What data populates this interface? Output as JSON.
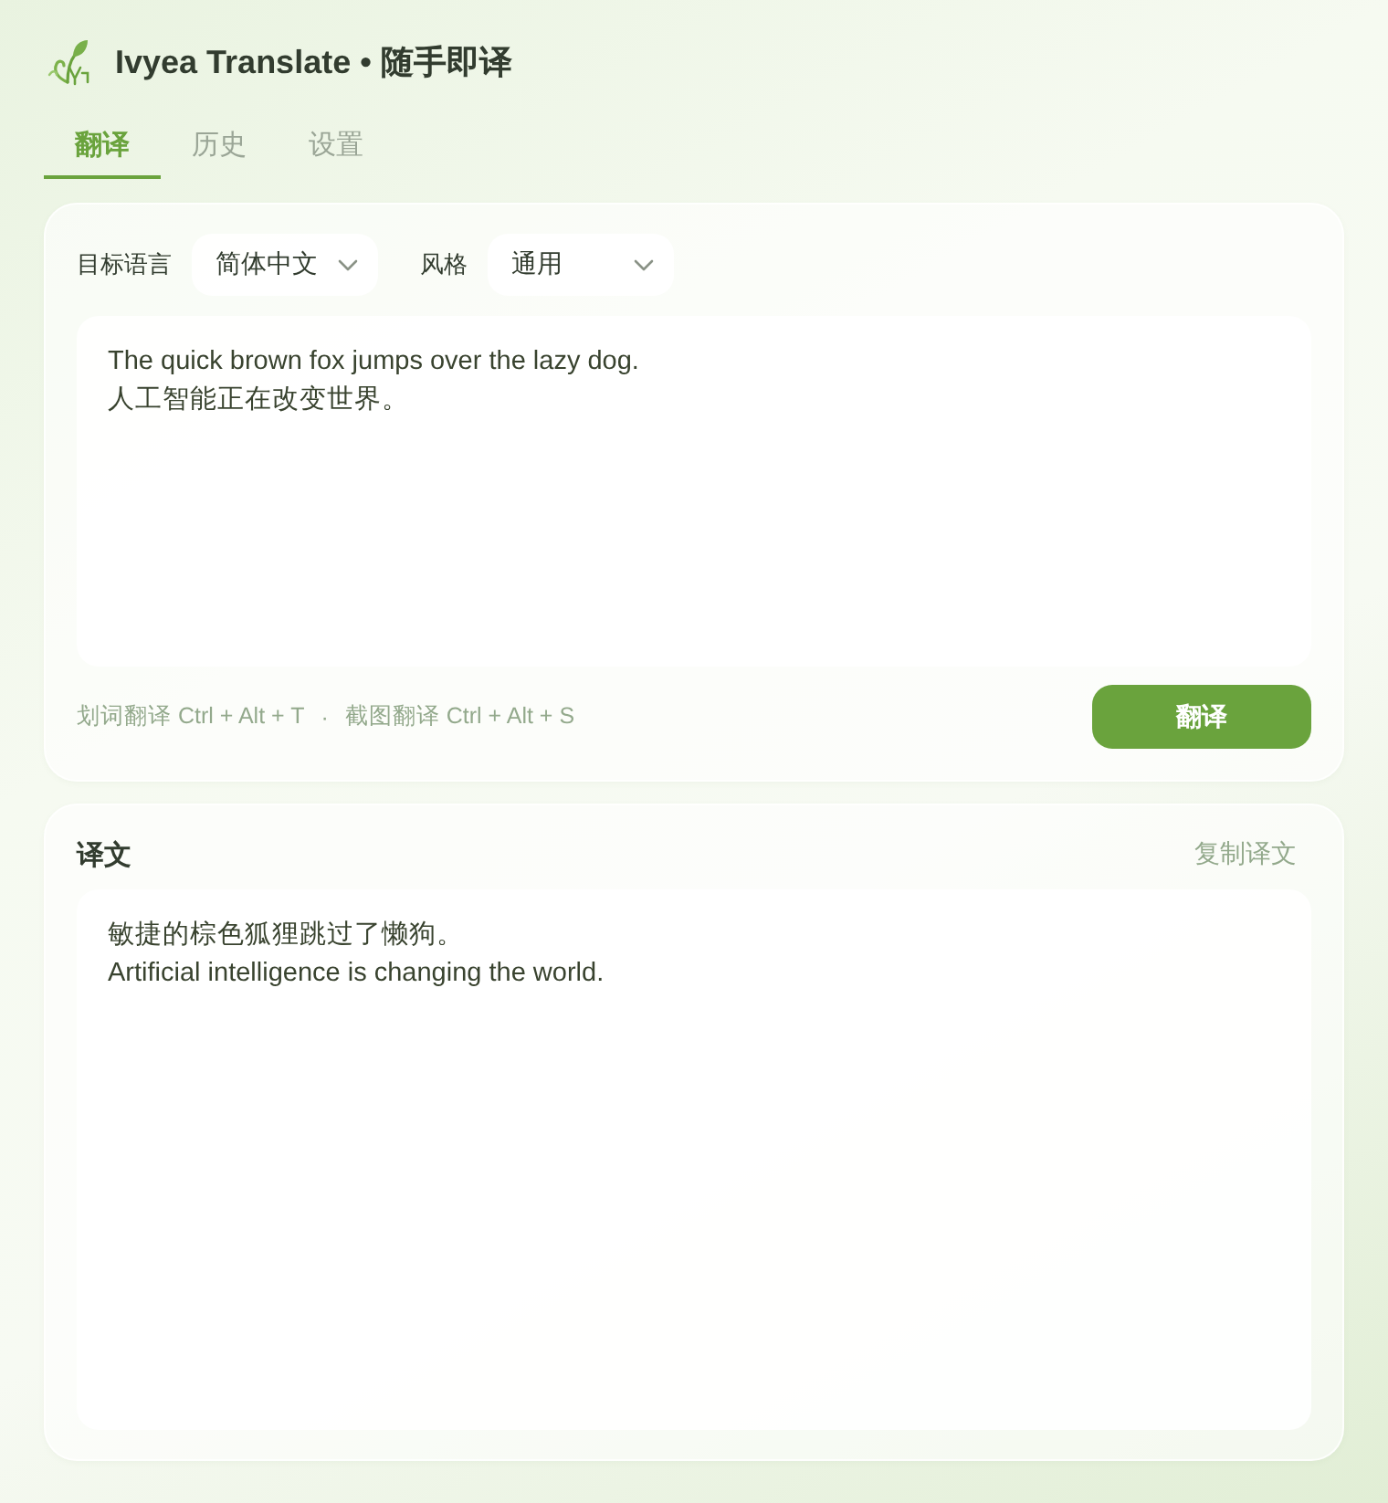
{
  "header": {
    "title": "Ivyea Translate • 随手即译"
  },
  "tabs": [
    {
      "label": "翻译",
      "selected": true
    },
    {
      "label": "历史",
      "selected": false
    },
    {
      "label": "设置",
      "selected": false
    }
  ],
  "input_card": {
    "fields": [
      {
        "label": "目标语言",
        "value": "简体中文"
      },
      {
        "label": "风格",
        "value": "通用"
      }
    ],
    "source_text": "The quick brown fox jumps over the lazy dog.\n人工智能正在改变世界。",
    "hints": [
      "划词翻译 Ctrl + Alt + T",
      "截图翻译 Ctrl + Alt + S"
    ],
    "hint_separator": "·",
    "button": "翻译"
  },
  "result_card": {
    "title": "译文",
    "copy_link": "复制译文",
    "text": "敏捷的棕色狐狸跳过了懒狗。\nArtificial intelligence is changing the world."
  }
}
